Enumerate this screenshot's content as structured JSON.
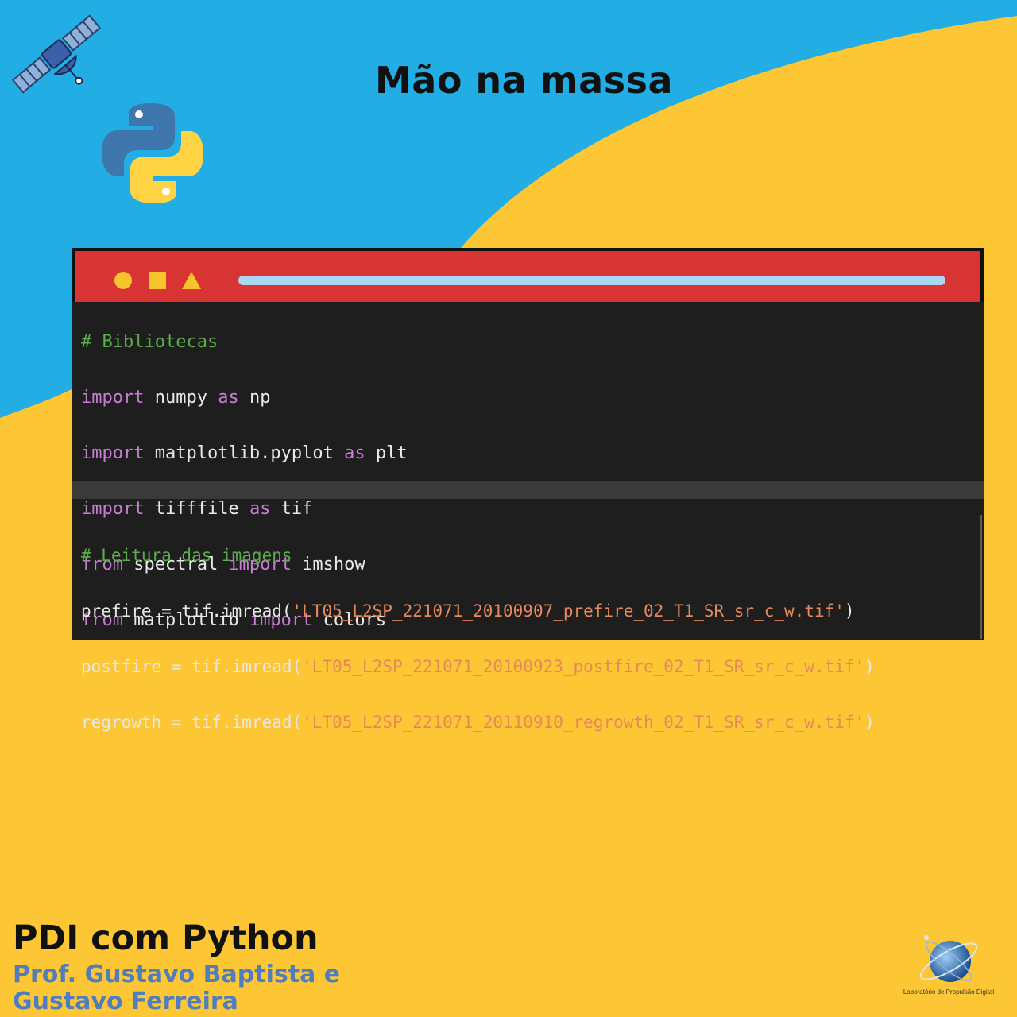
{
  "header": {
    "title": "Mão na massa"
  },
  "icons": {
    "satellite": "satellite-icon",
    "python": "python-logo",
    "globe": "globe-logo"
  },
  "colors": {
    "blue": "#22AEE4",
    "yellow": "#FDC635",
    "red": "#D93434",
    "editor_bg": "#1E1E1E"
  },
  "editor": {
    "block1": {
      "comment": "# Bibliotecas",
      "lines": [
        {
          "kw1": "import",
          "mid": " numpy ",
          "kw2": "as",
          "end": " np"
        },
        {
          "kw1": "import",
          "mid": " matplotlib.pyplot ",
          "kw2": "as",
          "end": " plt"
        },
        {
          "kw1": "import",
          "mid": " tifffile ",
          "kw2": "as",
          "end": " tif"
        },
        {
          "kw1": "from",
          "mid": " spectral ",
          "kw2": "import",
          "end": " imshow"
        },
        {
          "kw1": "from",
          "mid": " matplotlib ",
          "kw2": "import",
          "end": " colors"
        }
      ]
    },
    "block2": {
      "comment": "# Leitura das imagens",
      "lines": [
        {
          "pre": "prefire = tif.imread(",
          "str": "'LT05_L2SP_221071_20100907_prefire_02_T1_SR_sr_c_w.tif'",
          "post": ")"
        },
        {
          "pre": "postfire = tif.imread(",
          "str": "'LT05_L2SP_221071_20100923_postfire_02_T1_SR_sr_c_w.tif'",
          "post": ")"
        },
        {
          "pre": "regrowth = tif.imread(",
          "str": "'LT05_L2SP_221071_20110910_regrowth_02_T1_SR_sr_c_w.tif'",
          "post": ")"
        }
      ]
    }
  },
  "footer": {
    "course": "PDI com Python",
    "authors_line1": "Prof. Gustavo Baptista e",
    "authors_line2": "Gustavo Ferreira",
    "lab": "Laboratório de Propulsão Digital"
  }
}
